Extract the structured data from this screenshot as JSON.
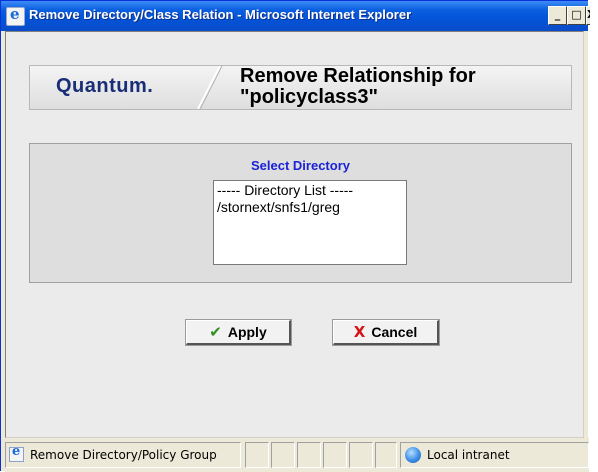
{
  "window": {
    "title": "Remove Directory/Class Relation - Microsoft Internet Explorer",
    "controls": {
      "minimize": "_",
      "maximize": "□",
      "close": "X"
    }
  },
  "header": {
    "logo": "Quantum.",
    "title": "Remove Relationship for \"policyclass3\""
  },
  "directory_panel": {
    "label": "Select Directory",
    "list_items": [
      "----- Directory List -----",
      "/stornext/snfs1/greg"
    ]
  },
  "buttons": {
    "apply": "Apply",
    "cancel": "Cancel"
  },
  "statusbar": {
    "text": "Remove Directory/Policy Group",
    "zone": "Local intranet"
  },
  "icons": {
    "title_icon": "ie-icon",
    "apply_icon": "checkmark-icon",
    "cancel_icon": "red-x-icon",
    "zone_icon": "globe-icon"
  },
  "colors": {
    "titlebar": "#0a5fe0",
    "select_label": "#1a22d8",
    "logo": "#1a2e78",
    "apply_check": "#2f8f1f",
    "cancel_x": "#d41414"
  }
}
